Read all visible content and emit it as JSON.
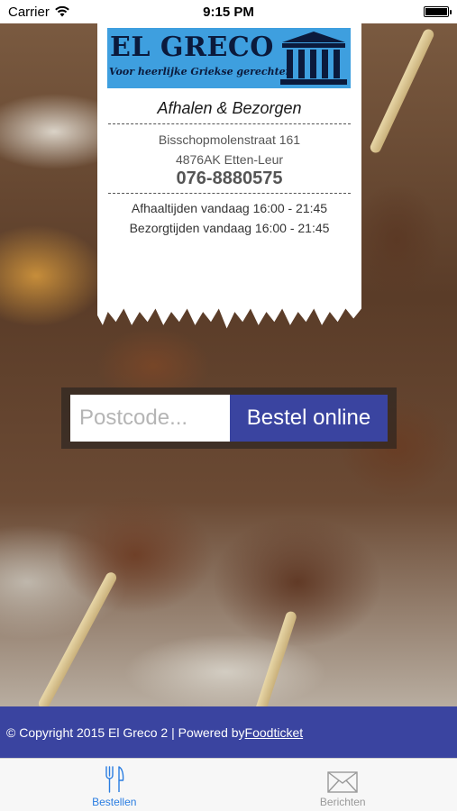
{
  "status_bar": {
    "carrier": "Carrier",
    "time": "9:15 PM",
    "battery_level": 1.0
  },
  "logo": {
    "title": "EL GRECO",
    "subtitle": "Voor heerlijke Griekse gerechten",
    "icon": "temple-icon"
  },
  "receipt": {
    "heading": "Afhalen & Bezorgen",
    "address_line1": "Bisschopmolenstraat 161",
    "address_line2": "4876AK Etten-Leur",
    "phone": "076-8880575",
    "pickup_hours": "Afhaaltijden vandaag 16:00 - 21:45",
    "delivery_hours": "Bezorgtijden vandaag 16:00 - 21:45"
  },
  "order": {
    "postcode_placeholder": "Postcode...",
    "postcode_value": "",
    "button_label": "Bestel online"
  },
  "footer": {
    "copyright": "© Copyright 2015 El Greco 2 | Powered by ",
    "link_label": "Foodticket"
  },
  "tabs": [
    {
      "label": "Bestellen",
      "icon": "fork-knife-icon",
      "active": true
    },
    {
      "label": "Berichten",
      "icon": "envelope-icon",
      "active": false
    }
  ],
  "colors": {
    "accent": "#3a44a0",
    "active_tab": "#2a7de1",
    "logo_bg": "#3e9fdf"
  }
}
